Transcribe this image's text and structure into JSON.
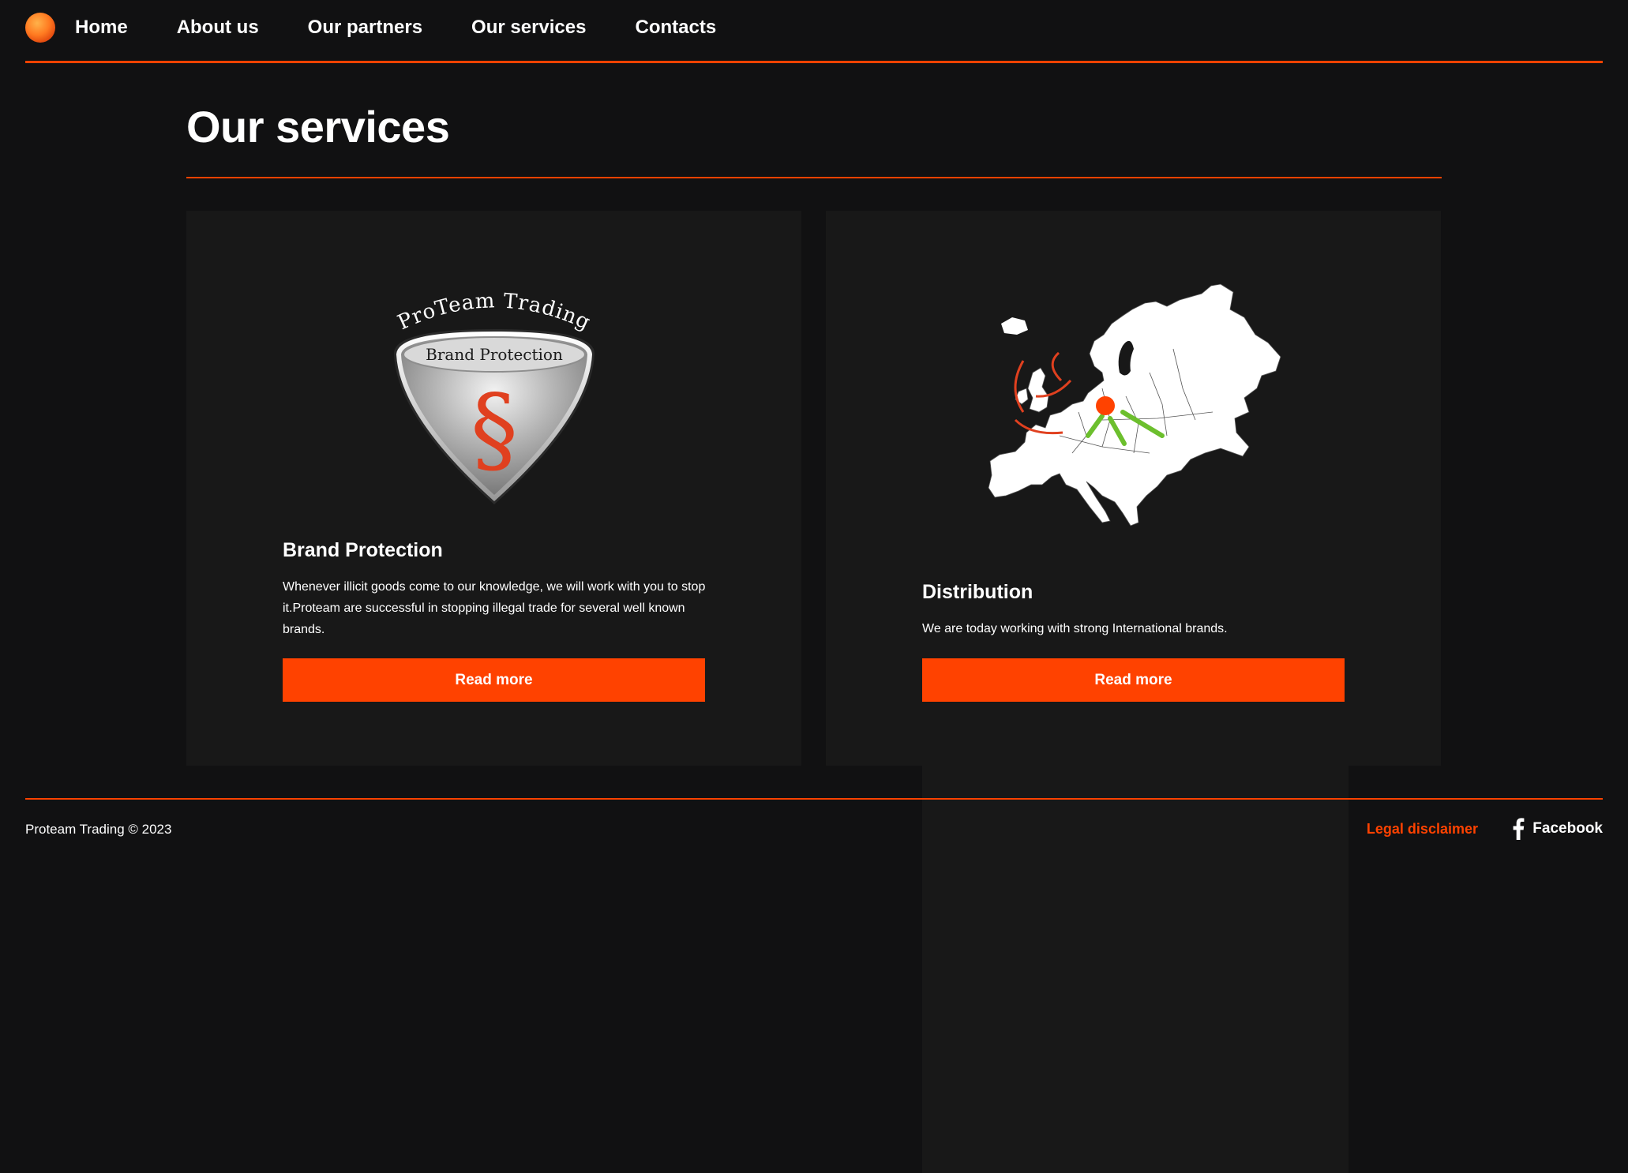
{
  "header": {
    "logo": "logo-icon",
    "nav": [
      {
        "label": "Home"
      },
      {
        "label": "About us"
      },
      {
        "label": "Our partners"
      },
      {
        "label": "Our services"
      },
      {
        "label": "Contacts"
      }
    ]
  },
  "main": {
    "title": "Our services",
    "services": [
      {
        "image_text_top": "ProTeam Trading",
        "image_text_inner": "Brand Protection",
        "image_symbol": "§",
        "heading": "Brand Protection",
        "text": "Whenever illicit goods come to our knowledge, we will work with you to stop it.Proteam are successful in stopping illegal trade for several well known brands.",
        "button": "Read more"
      },
      {
        "image": "europe-map-icon",
        "heading": "Distribution",
        "text": "We are today working with strong International brands.",
        "button": "Read more"
      }
    ]
  },
  "footer": {
    "copyright": "Proteam Trading © 2023",
    "legal": "Legal disclaimer",
    "facebook": "Facebook"
  },
  "colors": {
    "accent": "#ff4200",
    "background": "#111112",
    "card": "#181818",
    "text": "#ffffff"
  }
}
